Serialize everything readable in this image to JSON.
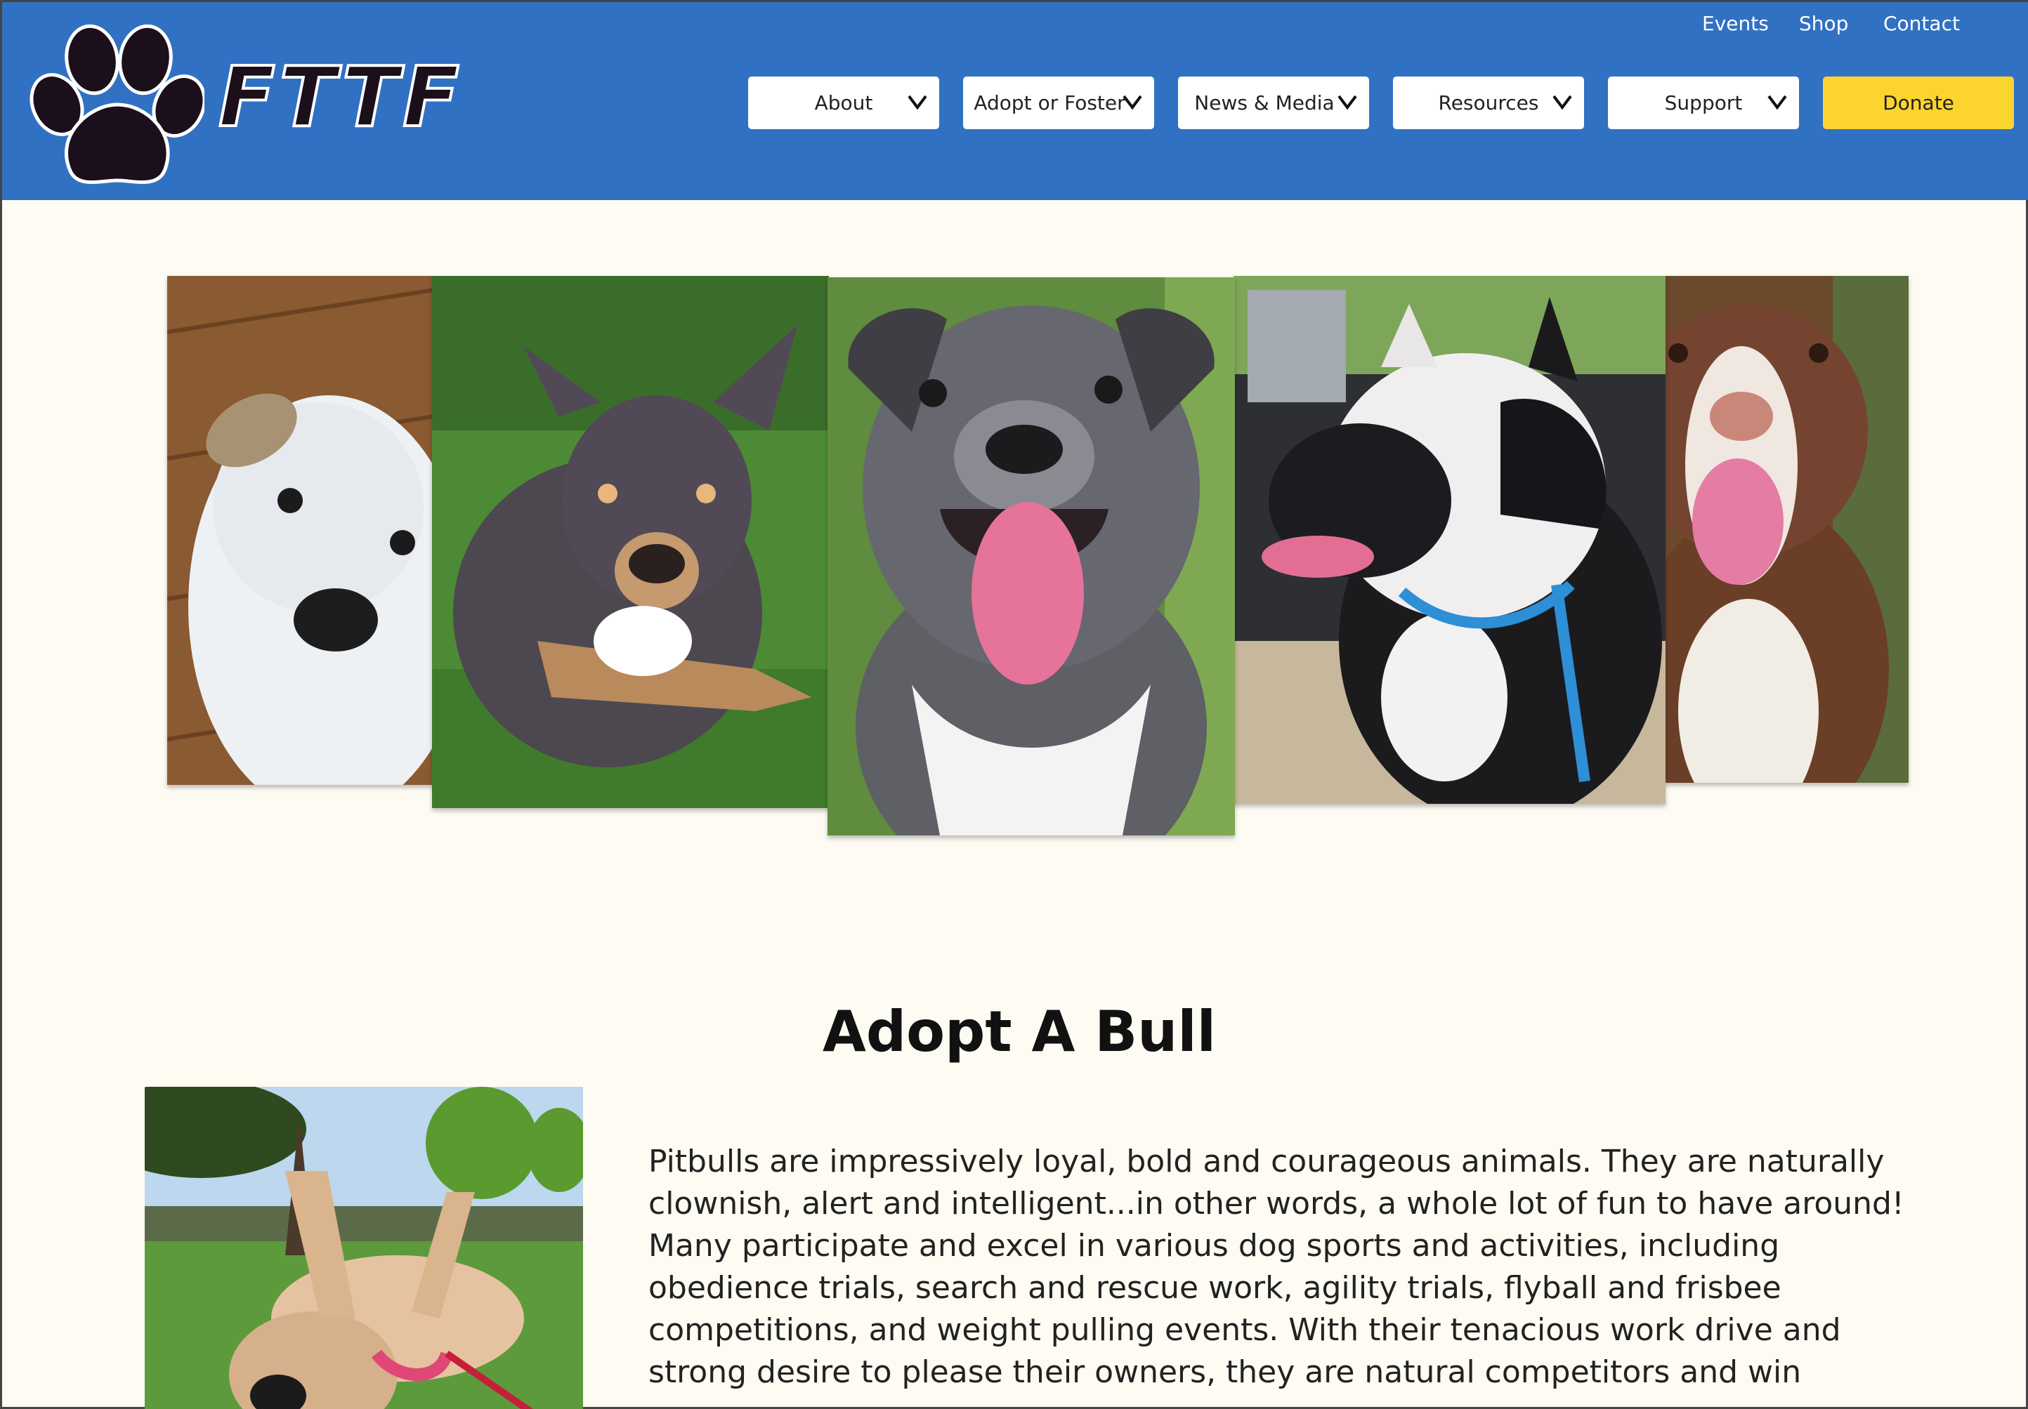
{
  "header": {
    "logo_text": "FTTF",
    "utility_links": [
      "Events",
      "Shop",
      "Contact"
    ],
    "nav": [
      {
        "label": "About"
      },
      {
        "label": "Adopt or Foster"
      },
      {
        "label": "News & Media"
      },
      {
        "label": "Resources"
      },
      {
        "label": "Support"
      }
    ],
    "donate_label": "Donate",
    "colors": {
      "bar": "#3171c3",
      "donate": "#fbd42e"
    }
  },
  "gallery": {
    "photos": [
      {
        "name": "white-puppy-photo"
      },
      {
        "name": "brindle-dog-on-grass-photo"
      },
      {
        "name": "gray-puppy-smiling-photo"
      },
      {
        "name": "black-white-dog-in-car-photo"
      },
      {
        "name": "brown-white-dog-photo"
      }
    ]
  },
  "main": {
    "heading": "Adopt A Bull",
    "paragraph": "Pitbulls are impressively loyal, bold and courageous animals. They are naturally clownish, alert and intelligent...in other words, a whole lot of fun to have around! Many participate and excel in various dog sports and activities, including obedience trials, search and rescue work, agility trials, flyball and frisbee competitions, and weight pulling events. With their tenacious work drive and strong desire to please their owners, they are natural competitors and win"
  }
}
